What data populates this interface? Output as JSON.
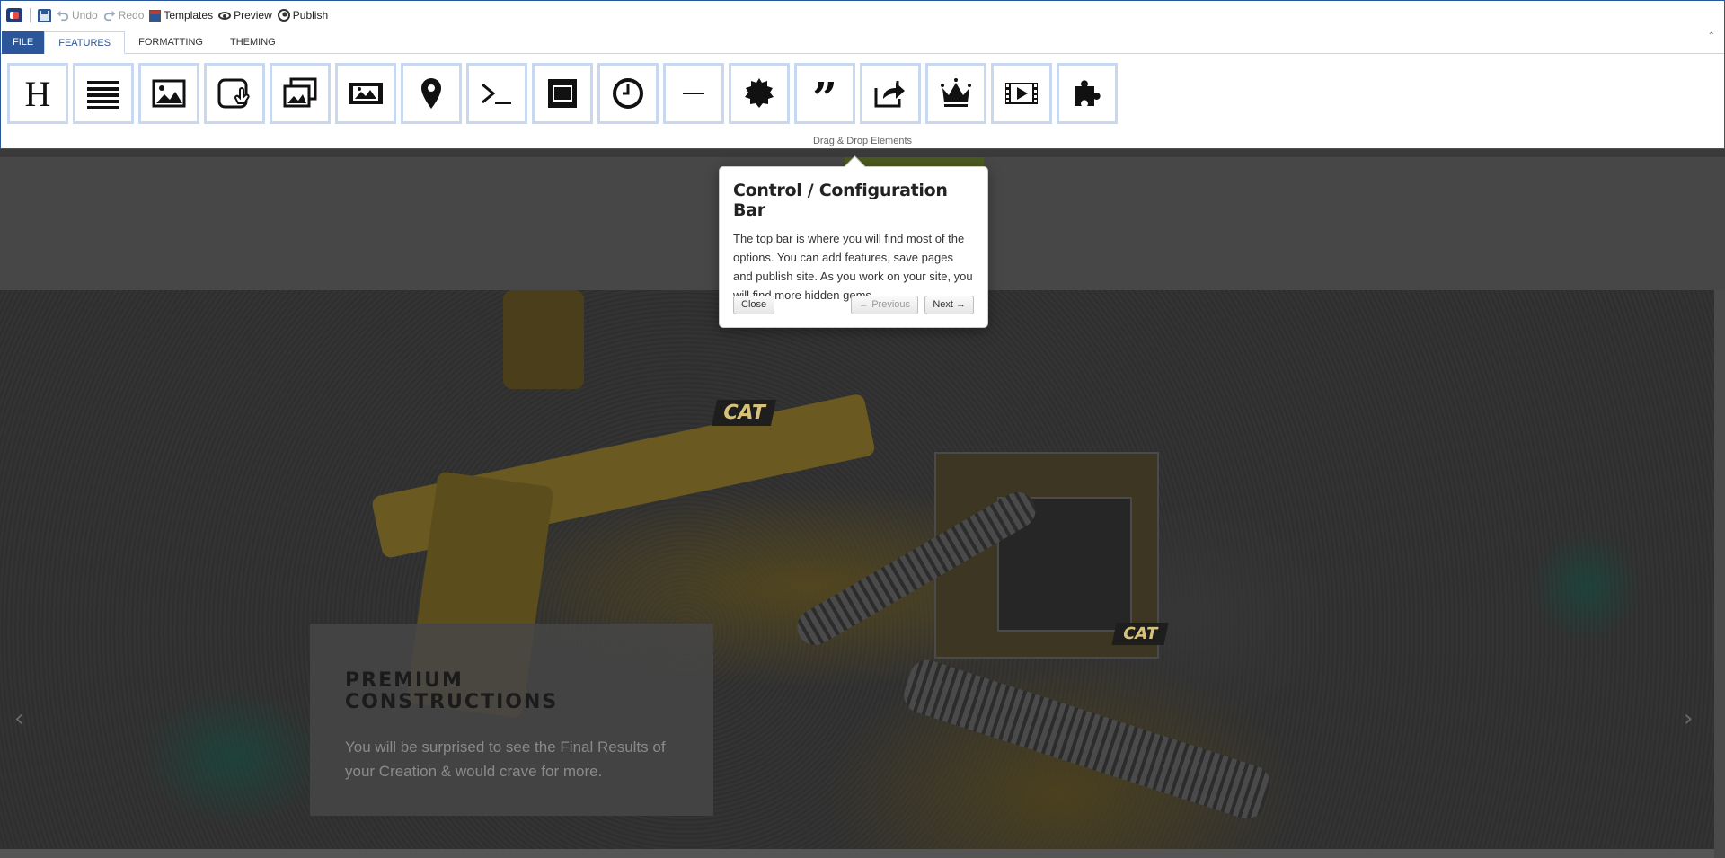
{
  "toolbar": {
    "undo_label": "Undo",
    "redo_label": "Redo",
    "templates_label": "Templates",
    "preview_label": "Preview",
    "publish_label": "Publish"
  },
  "tabs": [
    {
      "label": "FILE"
    },
    {
      "label": "FEATURES"
    },
    {
      "label": "FORMATTING"
    },
    {
      "label": "THEMING"
    }
  ],
  "active_tab": "FEATURES",
  "collapse_glyph": "⌃",
  "elements_group": {
    "label": "Drag & Drop Elements",
    "items": [
      {
        "icon": "heading-icon",
        "glyph": "H"
      },
      {
        "icon": "paragraph-icon"
      },
      {
        "icon": "image-icon"
      },
      {
        "icon": "button-icon"
      },
      {
        "icon": "gallery-icon"
      },
      {
        "icon": "slider-icon"
      },
      {
        "icon": "map-marker-icon"
      },
      {
        "icon": "code-icon"
      },
      {
        "icon": "box-icon"
      },
      {
        "icon": "clock-icon"
      },
      {
        "icon": "divider-icon"
      },
      {
        "icon": "badge-icon"
      },
      {
        "icon": "quote-icon"
      },
      {
        "icon": "share-icon"
      },
      {
        "icon": "crown-icon"
      },
      {
        "icon": "video-icon"
      },
      {
        "icon": "plugin-icon"
      }
    ]
  },
  "hero": {
    "title": "PREMIUM CONSTRUCTIONS",
    "text": "You will be surprised to see the Final Results of your Creation & would crave for more.",
    "prev_arrow": "‹",
    "next_arrow": "›",
    "badge_1": "CAT",
    "badge_2": "CAT"
  },
  "popover": {
    "title": "Control / Configuration Bar",
    "body": "The top bar is where you will find most of the options. You can add features, save pages and publish site. As you work on your site, you will find more hidden gems",
    "close_label": "Close",
    "prev_label": "← Previous",
    "next_label": "Next →"
  },
  "colors": {
    "accent": "#2b579a",
    "tile_border": "#c8d8f0",
    "overlay": "#3a3a3a"
  }
}
